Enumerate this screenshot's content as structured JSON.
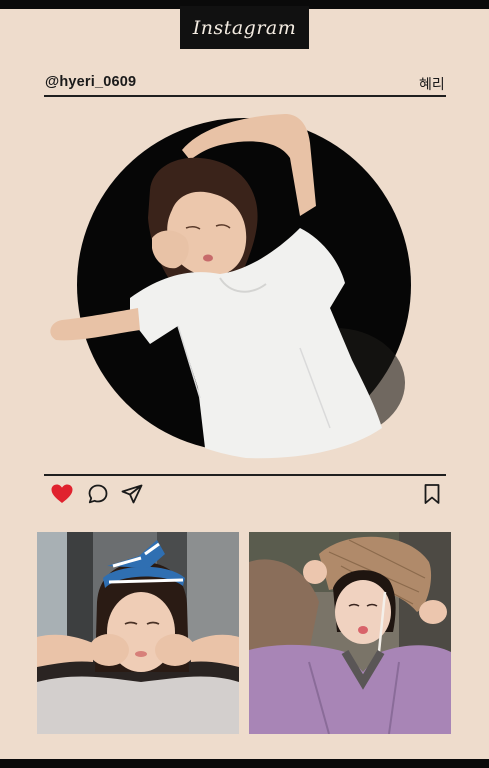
{
  "app": {
    "logo_text": "Instagram"
  },
  "post": {
    "handle": "@hyeri_0609",
    "display_name": "혜리"
  },
  "icons": {
    "like": "heart-icon",
    "comment": "comment-bubble-icon",
    "share": "send-icon",
    "save": "bookmark-icon"
  },
  "colors": {
    "background": "#eedccc",
    "logo_bg": "#111111",
    "heart": "#e0222e",
    "rule": "#1f1f1f"
  }
}
